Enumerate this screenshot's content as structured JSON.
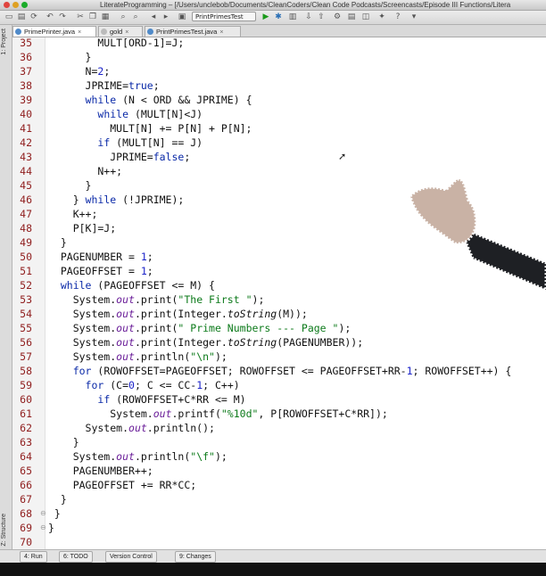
{
  "window": {
    "title": "LiterateProgramming – [/Users/unclebob/Documents/CleanCoders/Clean Code Podcasts/Screencasts/Episode III Functions/Litera"
  },
  "toolbar": {
    "run_config": "PrintPrimesTest"
  },
  "sidebar": {
    "project_label": "1: Project",
    "structure_label": "Z: Structure"
  },
  "tabs": [
    {
      "label": "PrimePrinter.java"
    },
    {
      "label": "gold"
    },
    {
      "label": "PrintPrimesTest.java"
    }
  ],
  "editor": {
    "line_numbers": [
      "35",
      "36",
      "37",
      "38",
      "39",
      "40",
      "41",
      "42",
      "43",
      "44",
      "45",
      "46",
      "47",
      "48",
      "49",
      "50",
      "51",
      "52",
      "53",
      "54",
      "55",
      "56",
      "57",
      "58",
      "59",
      "60",
      "61",
      "62",
      "63",
      "64",
      "65",
      "66",
      "67",
      "68",
      "69",
      "70"
    ]
  },
  "statusbar": {
    "run": "4: Run",
    "todo": "6: TODO",
    "vcs": "Version Control",
    "changes": "9: Changes"
  }
}
